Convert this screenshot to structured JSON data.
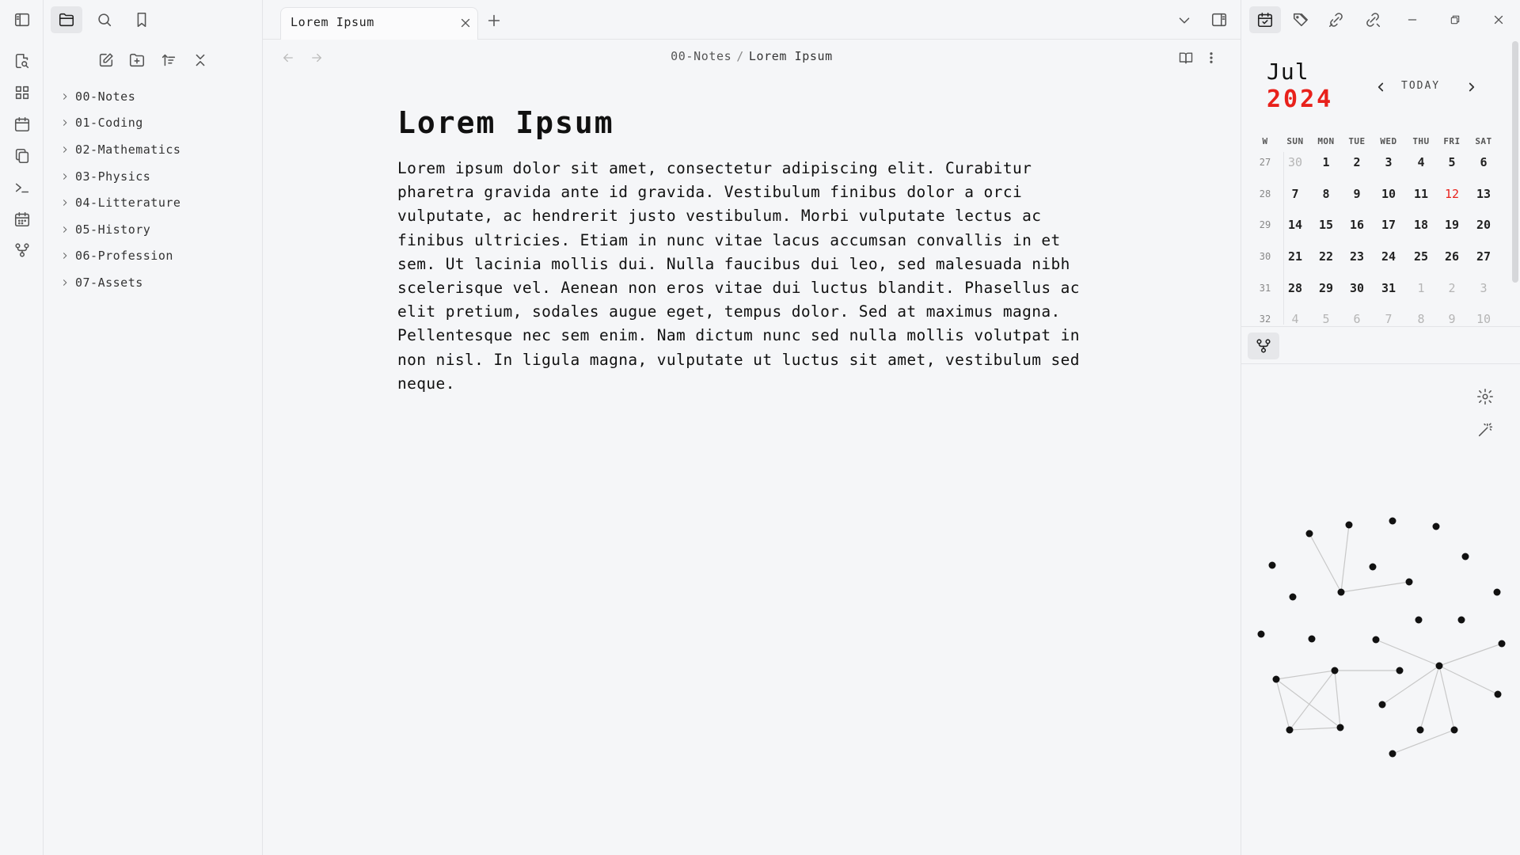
{
  "ribbon": {
    "icons": [
      "file-search-icon",
      "layout-grid-icon",
      "calendar-icon",
      "copy-files-icon",
      "terminal-icon",
      "calendar-days-icon",
      "git-fork-icon"
    ]
  },
  "explorer": {
    "folders": [
      {
        "label": "00-Notes"
      },
      {
        "label": "01-Coding"
      },
      {
        "label": "02-Mathematics"
      },
      {
        "label": "03-Physics"
      },
      {
        "label": "04-Litterature"
      },
      {
        "label": "05-History"
      },
      {
        "label": "06-Profession"
      },
      {
        "label": "07-Assets"
      }
    ]
  },
  "tabs": [
    {
      "label": "Lorem Ipsum"
    }
  ],
  "breadcrumb": {
    "folder": "00-Notes",
    "separator": "/",
    "file": "Lorem Ipsum"
  },
  "document": {
    "title": "Lorem Ipsum",
    "body": "Lorem ipsum dolor sit amet, consectetur adipiscing elit. Curabitur pharetra gravida ante id gravida. Vestibulum finibus dolor a orci vulputate, ac hendrerit justo vestibulum. Morbi vulputate lectus ac finibus ultricies. Etiam in nunc vitae lacus accumsan convallis in et sem. Ut lacinia mollis dui. Nulla faucibus dui leo, sed malesuada nibh scelerisque vel. Aenean non eros vitae dui luctus blandit. Phasellus ac elit pretium, sodales augue eget, tempus dolor. Sed at maximus magna. Pellentesque nec sem enim. Nam dictum nunc sed nulla mollis volutpat in non nisl. In ligula magna, vulputate ut luctus sit amet, vestibulum sed neque."
  },
  "calendar": {
    "month": "Jul",
    "year": "2024",
    "today_label": "TODAY",
    "colors": {
      "accent": "#e8211b"
    },
    "weekday_headers": [
      "W",
      "SUN",
      "MON",
      "TUE",
      "WED",
      "THU",
      "FRI",
      "SAT"
    ],
    "weeks": [
      {
        "week": "27",
        "days": [
          {
            "d": "30",
            "muted": true
          },
          {
            "d": "1"
          },
          {
            "d": "2"
          },
          {
            "d": "3"
          },
          {
            "d": "4"
          },
          {
            "d": "5"
          },
          {
            "d": "6"
          }
        ]
      },
      {
        "week": "28",
        "days": [
          {
            "d": "7"
          },
          {
            "d": "8"
          },
          {
            "d": "9"
          },
          {
            "d": "10"
          },
          {
            "d": "11"
          },
          {
            "d": "12",
            "today": true
          },
          {
            "d": "13"
          }
        ]
      },
      {
        "week": "29",
        "days": [
          {
            "d": "14"
          },
          {
            "d": "15"
          },
          {
            "d": "16"
          },
          {
            "d": "17"
          },
          {
            "d": "18"
          },
          {
            "d": "19"
          },
          {
            "d": "20"
          }
        ]
      },
      {
        "week": "30",
        "days": [
          {
            "d": "21"
          },
          {
            "d": "22"
          },
          {
            "d": "23"
          },
          {
            "d": "24"
          },
          {
            "d": "25"
          },
          {
            "d": "26"
          },
          {
            "d": "27"
          }
        ]
      },
      {
        "week": "31",
        "days": [
          {
            "d": "28"
          },
          {
            "d": "29"
          },
          {
            "d": "30"
          },
          {
            "d": "31"
          },
          {
            "d": "1",
            "muted": true
          },
          {
            "d": "2",
            "muted": true
          },
          {
            "d": "3",
            "muted": true
          }
        ]
      },
      {
        "week": "32",
        "days": [
          {
            "d": "4",
            "muted": true
          },
          {
            "d": "5",
            "muted": true
          },
          {
            "d": "6",
            "muted": true
          },
          {
            "d": "7",
            "muted": true
          },
          {
            "d": "8",
            "muted": true
          },
          {
            "d": "9",
            "muted": true
          },
          {
            "d": "10",
            "muted": true
          }
        ]
      }
    ]
  }
}
